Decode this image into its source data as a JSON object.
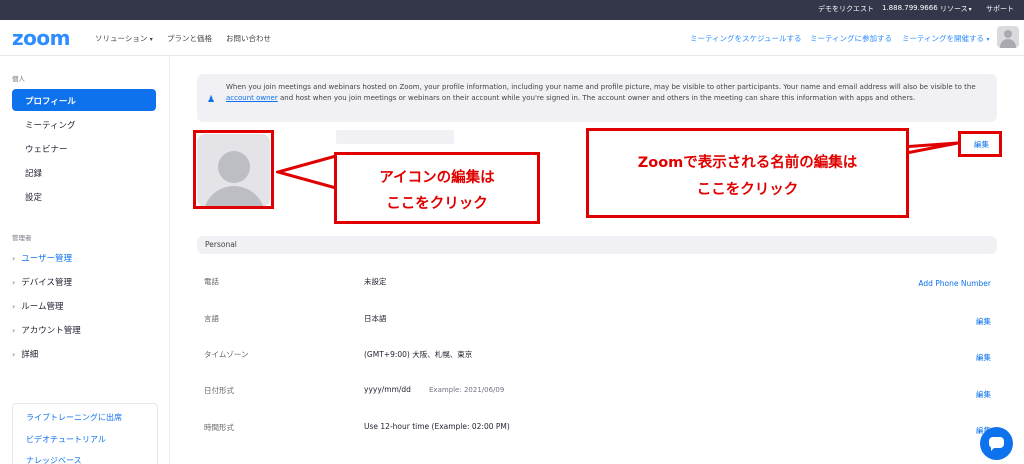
{
  "topbar": {
    "demo_request": "デモをリクエスト",
    "phone": "1.888.799.9666",
    "resources": "リソース",
    "support": "サポート"
  },
  "header": {
    "logo": "zoom",
    "nav": [
      "ソリューション",
      "プランと価格",
      "お問い合わせ"
    ],
    "actions": [
      "ミーティングをスケジュールする",
      "ミーティングに参加する",
      "ミーティングを開催する"
    ]
  },
  "sidebar": {
    "personal_label": "個人",
    "personal_items": [
      "プロフィール",
      "ミーティング",
      "ウェビナー",
      "記録",
      "設定"
    ],
    "admin_label": "管理者",
    "admin_items": [
      "ユーザー管理",
      "デバイス管理",
      "ルーム管理",
      "アカウント管理",
      "詳細"
    ],
    "links": [
      "ライブトレーニングに出席",
      "ビデオチュートリアル",
      "ナレッジベース"
    ]
  },
  "notice": {
    "text_before": "When you join meetings and webinars hosted on Zoom, your profile information, including your name and profile picture, may be visible to other participants. Your name and email address will also be visible to the ",
    "link": "account owner",
    "text_after": " and host when you join meetings or webinars on their account while you're signed in. The account owner and others in the meeting can share this information with apps and others."
  },
  "profile": {
    "edit_label": "編集"
  },
  "callouts": {
    "icon_edit": [
      "アイコンの編集は",
      "ここをクリック"
    ],
    "name_edit": [
      "Zoomで表示される名前の編集は",
      "ここをクリック"
    ]
  },
  "personal": {
    "section_title": "Personal",
    "rows": [
      {
        "label": "電話",
        "value": "未設定",
        "example": "",
        "action": "Add Phone Number"
      },
      {
        "label": "言語",
        "value": "日本語",
        "example": "",
        "action": "編集"
      },
      {
        "label": "タイムゾーン",
        "value": "(GMT+9:00) 大阪、札幌、東京",
        "example": "",
        "action": "編集"
      },
      {
        "label": "日付形式",
        "value": "yyyy/mm/dd",
        "example": "Example: 2021/06/09",
        "action": "編集"
      },
      {
        "label": "時間形式",
        "value": "Use 12-hour time (Example: 02:00 PM)",
        "example": "",
        "action": "編集"
      }
    ]
  },
  "colors": {
    "accent": "#0e72ed",
    "logo": "#2d8cff",
    "annotation_red": "#e00000",
    "topbar": "#34364a"
  }
}
